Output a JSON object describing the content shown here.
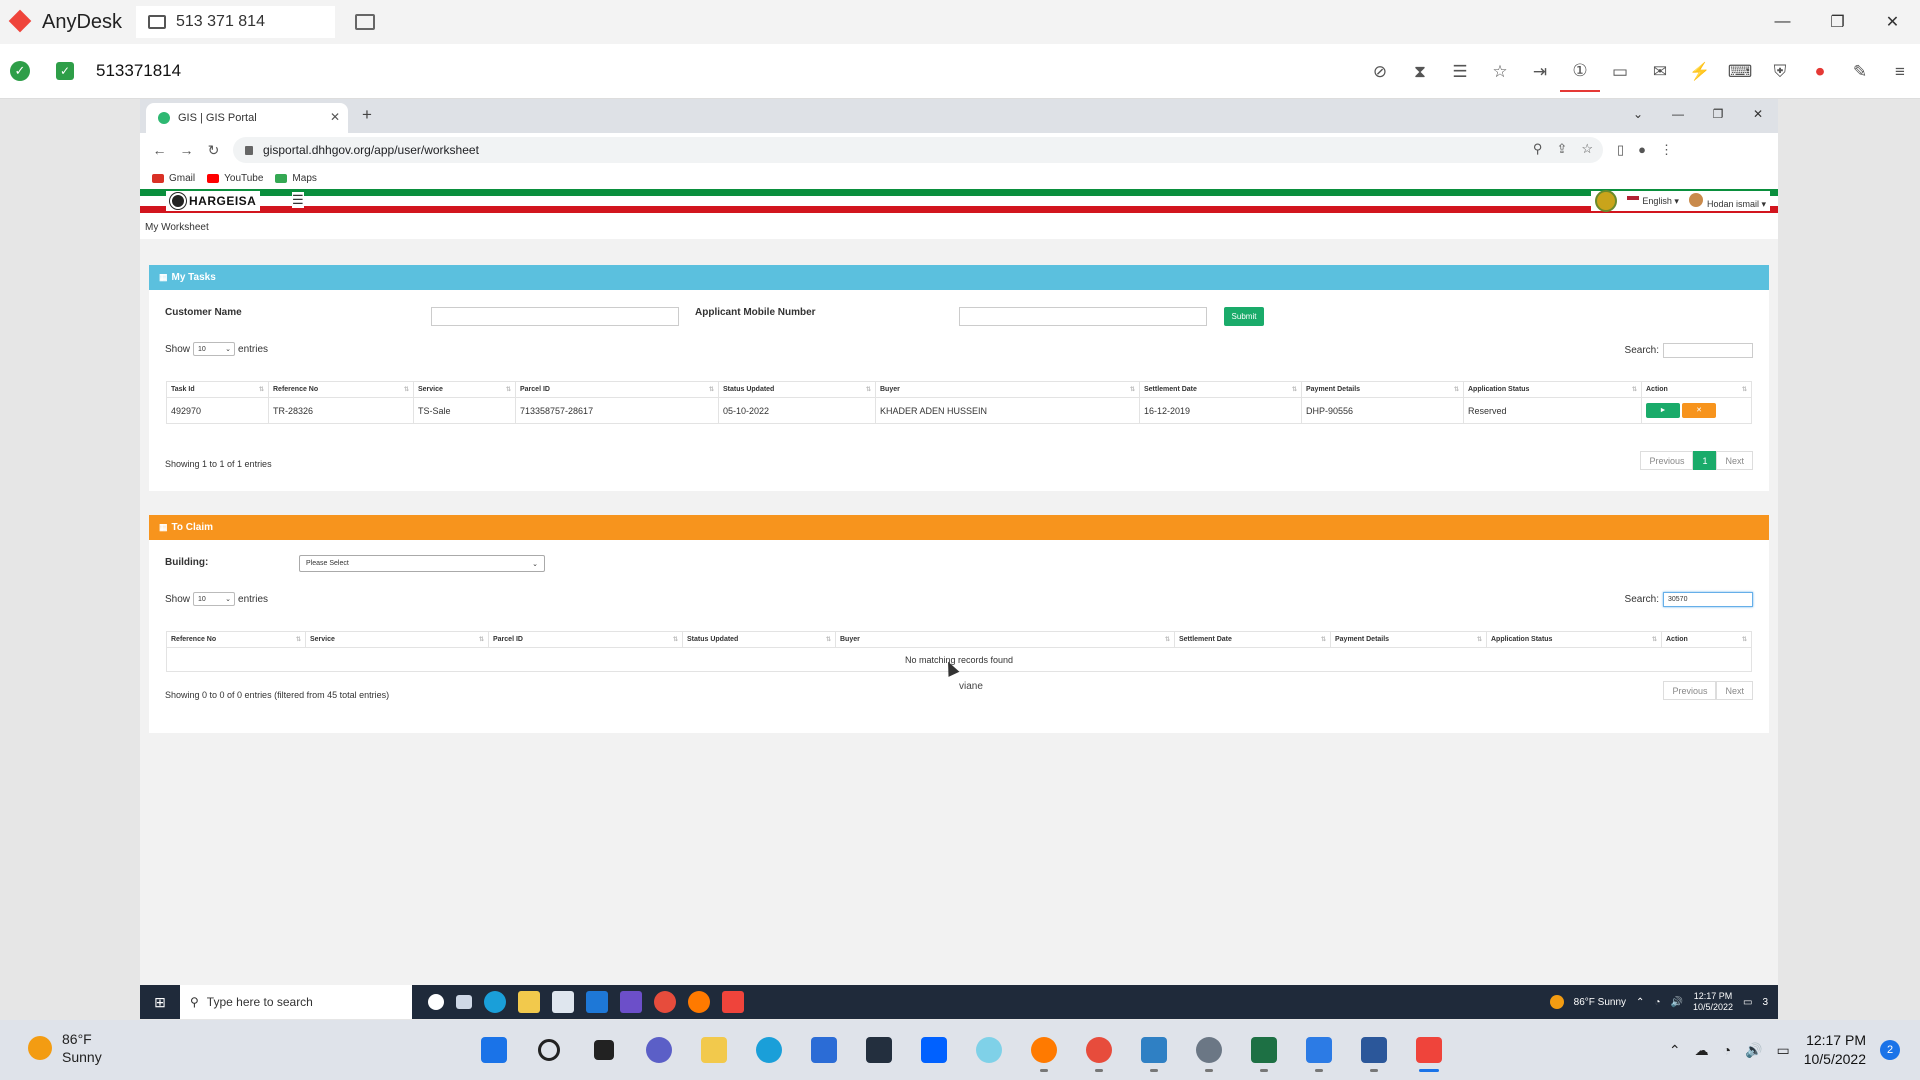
{
  "anydesk": {
    "app_name": "AnyDesk",
    "tab_label": "513 371 814",
    "remote_id": "513371814"
  },
  "chrome": {
    "tab_title": "GIS | GIS Portal",
    "url": "gisportal.dhhgov.org/app/user/worksheet",
    "bookmarks": [
      {
        "label": "Gmail",
        "color": "#d93025"
      },
      {
        "label": "YouTube",
        "color": "#ff0000"
      },
      {
        "label": "Maps",
        "color": "#34a853"
      }
    ]
  },
  "gis": {
    "logo_text": "HARGEISA",
    "language": "English ▾",
    "user": "Hodan ismail ▾",
    "breadcrumb": "My Worksheet",
    "colors": {
      "tasks_header": "#5bc0de",
      "claim_header": "#f7941d",
      "primary_button": "#1aab6a",
      "green_stripe": "#0a8f3d",
      "red_stripe": "#d2151e"
    }
  },
  "tasks": {
    "title": "My Tasks",
    "customer_name_label": "Customer Name",
    "mobile_label": "Applicant Mobile Number",
    "customer_name_value": "",
    "mobile_value": "",
    "submit_label": "Submit",
    "show_label": "Show",
    "page_size": "10",
    "entries_label": "entries",
    "search_label": "Search:",
    "search_value": "",
    "columns": [
      "Task Id",
      "Reference No",
      "Service",
      "Parcel ID",
      "Status Updated",
      "Buyer",
      "Settlement Date",
      "Payment Details",
      "Application Status",
      "Action"
    ],
    "rows": [
      {
        "task_id": "492970",
        "reference_no": "TR-28326",
        "service": "TS-Sale",
        "parcel_id": "713358757-28617",
        "status_updated": "05-10-2022",
        "buyer": "KHADER ADEN HUSSEIN",
        "settlement_date": "16-12-2019",
        "payment_details": "DHP-90556",
        "application_status": "Reserved",
        "action_go": "►",
        "action_x": "✕"
      }
    ],
    "info": "Showing 1 to 1 of 1 entries",
    "prev_label": "Previous",
    "current_page": "1",
    "next_label": "Next"
  },
  "claim": {
    "title": "To Claim",
    "building_label": "Building:",
    "building_selected": "Please Select",
    "show_label": "Show",
    "page_size": "10",
    "entries_label": "entries",
    "search_label": "Search:",
    "search_value": "30570",
    "columns": [
      "Reference No",
      "Service",
      "Parcel ID",
      "Status Updated",
      "Buyer",
      "Settlement Date",
      "Payment Details",
      "Application Status",
      "Action"
    ],
    "empty_message": "No matching records found",
    "info": "Showing 0 to 0 of 0 entries (filtered from 45 total entries)",
    "prev_label": "Previous",
    "next_label": "Next",
    "floating_text": "viane"
  },
  "remote_taskbar": {
    "search_placeholder": "Type here to search",
    "weather": "86°F  Sunny",
    "time": "12:17 PM",
    "date": "10/5/2022",
    "notif_count": "3"
  },
  "local_taskbar": {
    "temp": "86°F",
    "condition": "Sunny",
    "time": "12:17 PM",
    "date": "10/5/2022",
    "notif_count": "2"
  }
}
